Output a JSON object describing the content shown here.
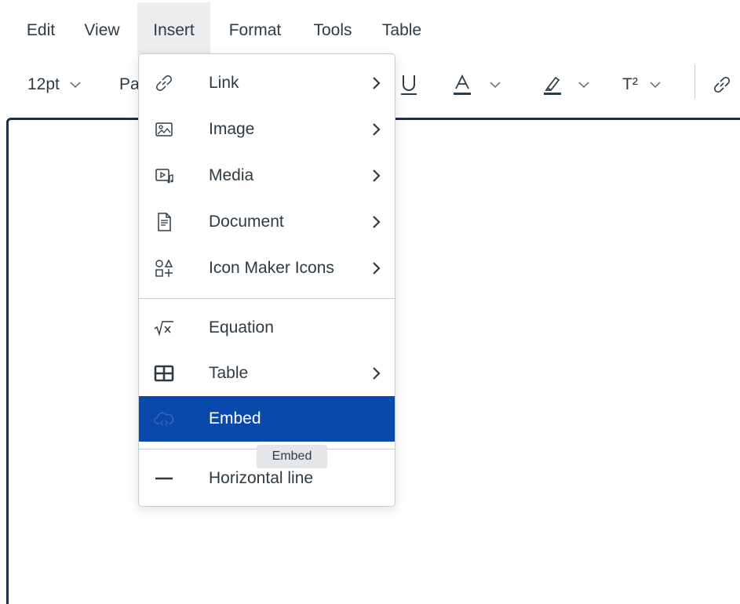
{
  "menubar": {
    "items": [
      {
        "label": "Edit"
      },
      {
        "label": "View"
      },
      {
        "label": "Insert"
      },
      {
        "label": "Format"
      },
      {
        "label": "Tools"
      },
      {
        "label": "Table"
      }
    ]
  },
  "toolbar": {
    "font_size": "12pt",
    "paragraph_partial": "Pa",
    "superscript_label": "T²",
    "icons": [
      "chevron-down-icon",
      "underline-icon",
      "text-color-icon",
      "highlight-icon",
      "superscript-icon",
      "link-icon"
    ]
  },
  "insert_menu": {
    "items": [
      {
        "label": "Link",
        "icon": "link-icon",
        "submenu": true
      },
      {
        "label": "Image",
        "icon": "image-icon",
        "submenu": true
      },
      {
        "label": "Media",
        "icon": "media-icon",
        "submenu": true
      },
      {
        "label": "Document",
        "icon": "document-icon",
        "submenu": true
      },
      {
        "label": "Icon Maker Icons",
        "icon": "icon-maker-icon",
        "submenu": true
      },
      {
        "label": "Equation",
        "icon": "equation-icon",
        "submenu": false
      },
      {
        "label": "Table",
        "icon": "table-icon",
        "submenu": true
      },
      {
        "label": "Embed",
        "icon": "cloud-embed-icon",
        "submenu": false,
        "highlighted": true
      },
      {
        "label": "Horizontal line",
        "icon": "horizontal-line-icon",
        "submenu": false
      }
    ]
  },
  "tooltip": {
    "text": "Embed"
  },
  "colors": {
    "highlight": "#0a49ac",
    "text": "#2d3b45",
    "editor_border": "#1f2f44",
    "active_menu_bg": "#ecedee"
  }
}
